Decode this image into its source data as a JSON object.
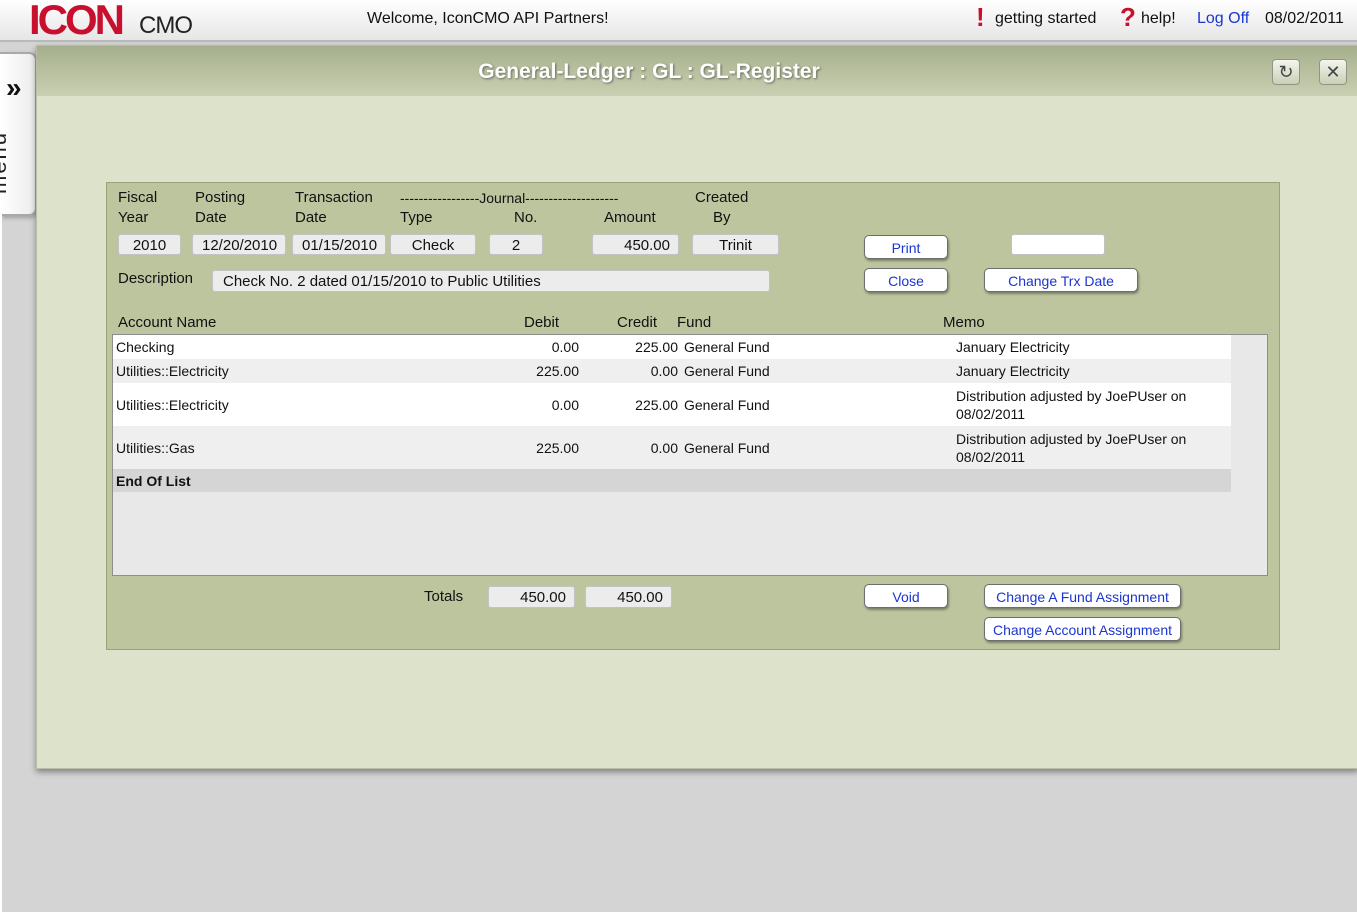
{
  "header": {
    "logo_main": "ICON",
    "logo_sub": "CMO",
    "welcome": "Welcome, IconCMO API Partners!",
    "getting_started": "getting started",
    "help": "help!",
    "logoff": "Log Off",
    "date": "08/02/2011"
  },
  "menu": {
    "label": "menu",
    "arrow": "»"
  },
  "window": {
    "title": "General-Ledger : GL : GL-Register",
    "refresh_glyph": "↻",
    "close_glyph": "✕"
  },
  "form": {
    "labels": {
      "fiscal": "Fiscal",
      "year": "Year",
      "posting": "Posting",
      "posting_date": "Date",
      "transaction": "Transaction",
      "transaction_date": "Date",
      "journal": "-----------------Journal--------------------",
      "type": "Type",
      "no": "No.",
      "amount": "Amount",
      "created": "Created",
      "by": "By",
      "description": "Description",
      "totals": "Totals"
    },
    "values": {
      "fiscal_year": "2010",
      "posting_date": "12/20/2010",
      "transaction_date": "01/15/2010",
      "type": "Check",
      "no": "2",
      "amount": "450.00",
      "created_by": "Trinit",
      "description": "Check No. 2 dated 01/15/2010 to Public Utilities",
      "blank_field": "",
      "total_debit": "450.00",
      "total_credit": "450.00"
    },
    "buttons": {
      "print": "Print",
      "close": "Close",
      "change_trx_date": "Change Trx Date",
      "void": "Void",
      "change_fund": "Change A Fund Assignment",
      "change_account": "Change Account Assignment"
    }
  },
  "table": {
    "columns": {
      "account": "Account Name",
      "debit": "Debit",
      "credit": "Credit",
      "fund": "Fund",
      "memo": "Memo"
    },
    "rows": [
      {
        "account": "Checking",
        "debit": "0.00",
        "credit": "225.00",
        "fund": "General Fund",
        "memo": "January Electricity"
      },
      {
        "account": "Utilities::Electricity",
        "debit": "225.00",
        "credit": "0.00",
        "fund": "General Fund",
        "memo": "January Electricity"
      },
      {
        "account": "Utilities::Electricity",
        "debit": "0.00",
        "credit": "225.00",
        "fund": "General Fund",
        "memo": "Distribution adjusted by JoePUser on 08/02/2011"
      },
      {
        "account": "Utilities::Gas",
        "debit": "225.00",
        "credit": "0.00",
        "fund": "General Fund",
        "memo": "Distribution adjusted by JoePUser on 08/02/2011"
      }
    ],
    "end_label": "End Of List"
  }
}
